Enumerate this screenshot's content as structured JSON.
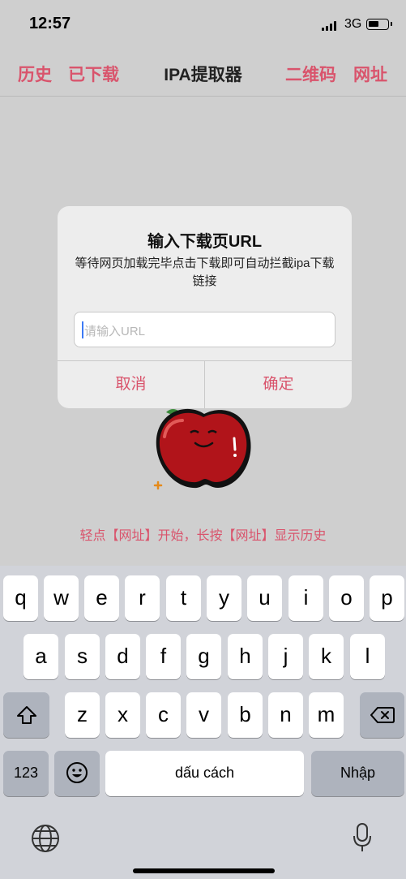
{
  "status": {
    "time": "12:57",
    "network": "3G"
  },
  "nav": {
    "history": "历史",
    "downloaded": "已下载",
    "title": "IPA提取器",
    "qrcode": "二维码",
    "url": "网址"
  },
  "hint": "轻点【网址】开始，长按【网址】显示历史",
  "alert": {
    "title": "输入下载页URL",
    "message": "等待网页加载完毕点击下载即可自动拦截ipa下载链接",
    "placeholder": "请输入URL",
    "cancel": "取消",
    "confirm": "确定"
  },
  "keyboard": {
    "row1": [
      "q",
      "w",
      "e",
      "r",
      "t",
      "y",
      "u",
      "i",
      "o",
      "p"
    ],
    "row2": [
      "a",
      "s",
      "d",
      "f",
      "g",
      "h",
      "j",
      "k",
      "l"
    ],
    "row3": [
      "z",
      "x",
      "c",
      "v",
      "b",
      "n",
      "m"
    ],
    "numbers": "123",
    "space": "dấu cách",
    "return": "Nhập"
  },
  "colors": {
    "accent": "#d9546c",
    "keyboard_bg": "#d1d3d9"
  }
}
